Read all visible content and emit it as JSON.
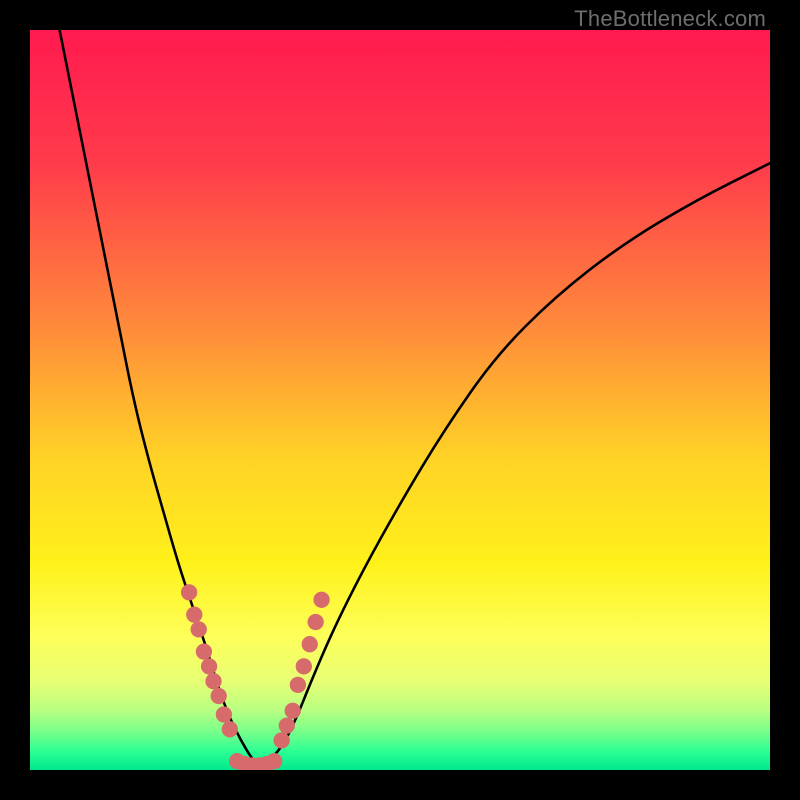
{
  "watermark": "TheBottleneck.com",
  "chart_data": {
    "type": "line",
    "title": "",
    "xlabel": "",
    "ylabel": "",
    "xlim": [
      0,
      100
    ],
    "ylim": [
      0,
      100
    ],
    "grid": false,
    "legend": false,
    "gradient_stops": [
      {
        "pos": 0.0,
        "color": "#ff1a4f"
      },
      {
        "pos": 0.18,
        "color": "#ff3b4b"
      },
      {
        "pos": 0.4,
        "color": "#ff8a3b"
      },
      {
        "pos": 0.58,
        "color": "#ffd326"
      },
      {
        "pos": 0.72,
        "color": "#fff11a"
      },
      {
        "pos": 0.82,
        "color": "#fdff5a"
      },
      {
        "pos": 0.88,
        "color": "#e8ff74"
      },
      {
        "pos": 0.92,
        "color": "#b7ff82"
      },
      {
        "pos": 0.95,
        "color": "#73ff8a"
      },
      {
        "pos": 0.975,
        "color": "#2bff94"
      },
      {
        "pos": 1.0,
        "color": "#00e88d"
      }
    ],
    "series": [
      {
        "name": "bottleneck-curve",
        "x": [
          4,
          6,
          8,
          10,
          12,
          14,
          16,
          18,
          20,
          22,
          24,
          25.5,
          27,
          28.5,
          30,
          31,
          32,
          34,
          36,
          38,
          41,
          45,
          50,
          56,
          63,
          71,
          80,
          90,
          100
        ],
        "y": [
          100,
          90,
          80,
          70,
          60,
          50,
          42,
          35,
          28,
          22,
          16,
          11,
          7,
          4,
          1.5,
          0.5,
          1,
          3,
          7,
          12,
          19,
          27,
          36,
          46,
          56,
          64,
          71,
          77,
          82
        ]
      }
    ],
    "markers": {
      "name": "highlighted-points",
      "color": "#d76a6a",
      "points": [
        {
          "x": 21.5,
          "y": 24
        },
        {
          "x": 22.2,
          "y": 21
        },
        {
          "x": 22.8,
          "y": 19
        },
        {
          "x": 23.5,
          "y": 16
        },
        {
          "x": 24.2,
          "y": 14
        },
        {
          "x": 24.8,
          "y": 12
        },
        {
          "x": 25.5,
          "y": 10
        },
        {
          "x": 26.2,
          "y": 7.5
        },
        {
          "x": 27.0,
          "y": 5.5
        },
        {
          "x": 28.0,
          "y": 1.2
        },
        {
          "x": 29.0,
          "y": 0.8
        },
        {
          "x": 30.0,
          "y": 0.6
        },
        {
          "x": 31.0,
          "y": 0.6
        },
        {
          "x": 32.0,
          "y": 0.8
        },
        {
          "x": 33.0,
          "y": 1.2
        },
        {
          "x": 34.0,
          "y": 4
        },
        {
          "x": 34.7,
          "y": 6
        },
        {
          "x": 35.5,
          "y": 8
        },
        {
          "x": 36.2,
          "y": 11.5
        },
        {
          "x": 37.0,
          "y": 14
        },
        {
          "x": 37.8,
          "y": 17
        },
        {
          "x": 38.6,
          "y": 20
        },
        {
          "x": 39.4,
          "y": 23
        }
      ]
    }
  }
}
